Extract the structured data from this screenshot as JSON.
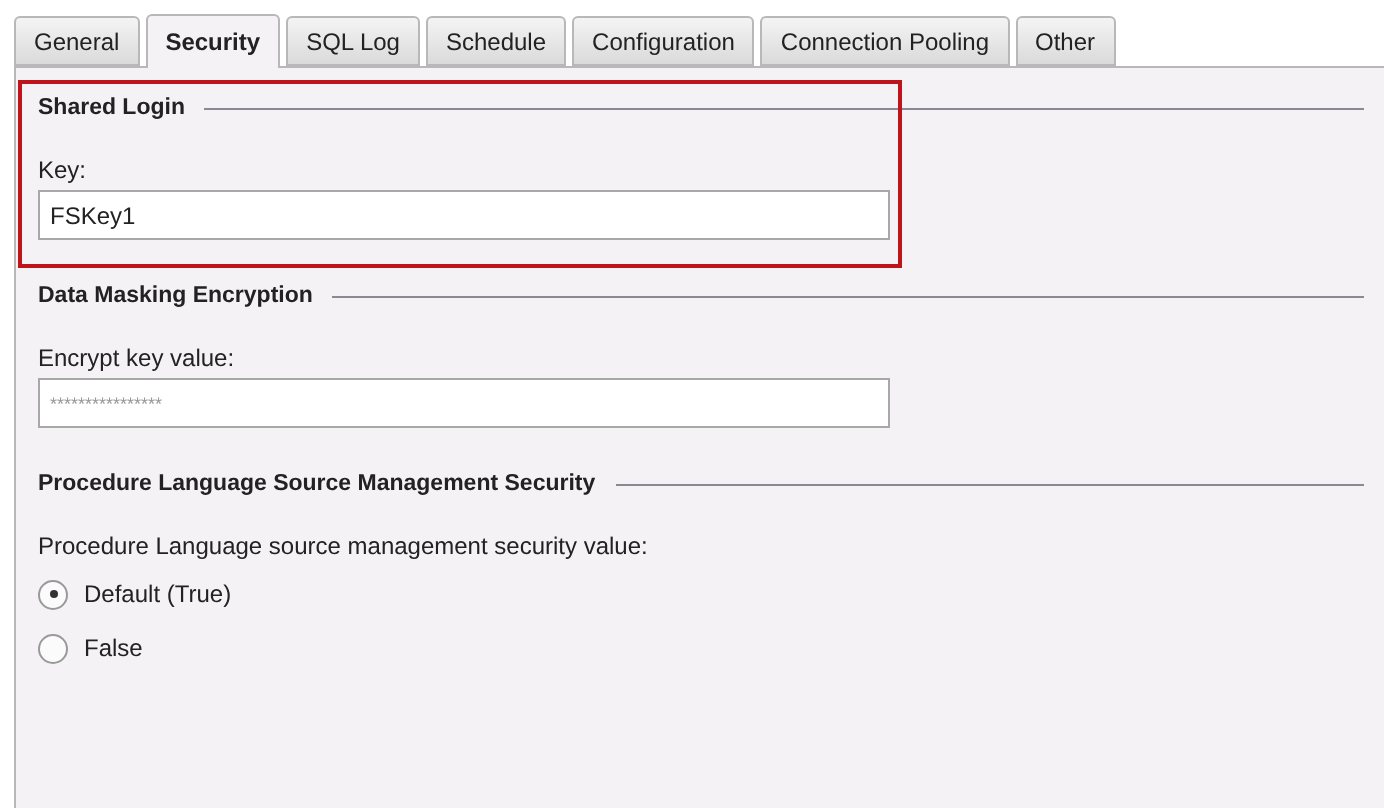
{
  "tabs": [
    {
      "label": "General",
      "selected": false
    },
    {
      "label": "Security",
      "selected": true
    },
    {
      "label": "SQL Log",
      "selected": false
    },
    {
      "label": "Schedule",
      "selected": false
    },
    {
      "label": "Configuration",
      "selected": false
    },
    {
      "label": "Connection Pooling",
      "selected": false
    },
    {
      "label": "Other",
      "selected": false
    }
  ],
  "sections": [
    {
      "title": "Shared Login",
      "highlighted": true,
      "kind": "text",
      "label": "Key:",
      "value": "FSKey1"
    },
    {
      "title": "Data Masking Encryption",
      "highlighted": false,
      "kind": "password",
      "label": "Encrypt key value:",
      "value": "****************"
    },
    {
      "title": "Procedure Language Source Management Security",
      "highlighted": false,
      "kind": "radio",
      "label": "Procedure Language source management security value:",
      "options": [
        {
          "label": "Default (True)",
          "selected": true
        },
        {
          "label": "False",
          "selected": false
        }
      ]
    }
  ]
}
